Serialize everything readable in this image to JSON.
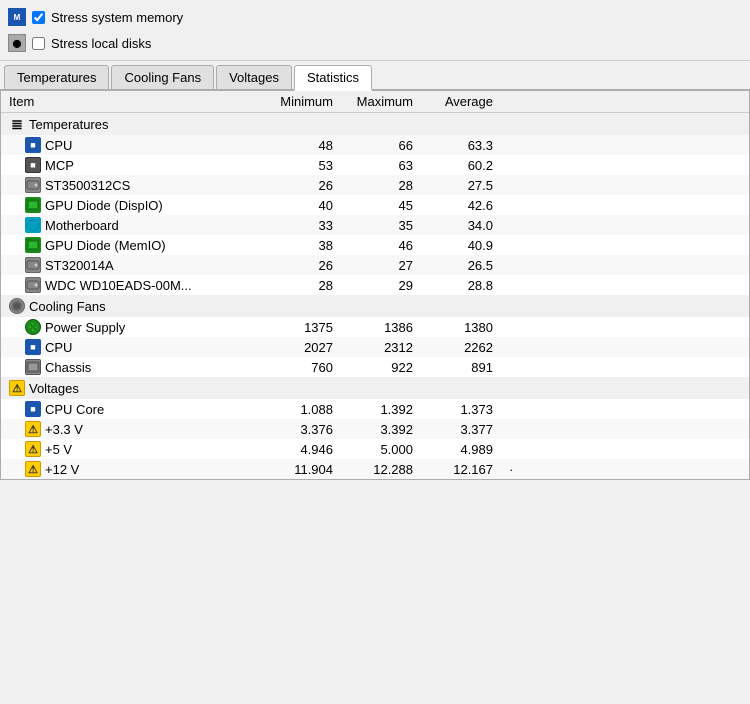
{
  "topSection": {
    "stressMemory": {
      "label": "Stress system memory",
      "checked": true
    },
    "stressDisks": {
      "label": "Stress local disks",
      "checked": false
    }
  },
  "tabs": [
    {
      "id": "temperatures",
      "label": "Temperatures",
      "active": false
    },
    {
      "id": "coolingfans",
      "label": "Cooling Fans",
      "active": false
    },
    {
      "id": "voltages",
      "label": "Voltages",
      "active": false
    },
    {
      "id": "statistics",
      "label": "Statistics",
      "active": true
    }
  ],
  "table": {
    "headers": {
      "item": "Item",
      "minimum": "Minimum",
      "maximum": "Maximum",
      "average": "Average"
    },
    "sections": [
      {
        "id": "temperatures",
        "label": "Temperatures",
        "iconType": "section-temp",
        "items": [
          {
            "id": "cpu",
            "label": "CPU",
            "iconType": "cpu",
            "min": "48",
            "max": "66",
            "avg": "63.3"
          },
          {
            "id": "mcp",
            "label": "MCP",
            "iconType": "mcp",
            "min": "53",
            "max": "63",
            "avg": "60.2"
          },
          {
            "id": "st3500312cs",
            "label": "ST3500312CS",
            "iconType": "hdd",
            "min": "26",
            "max": "28",
            "avg": "27.5"
          },
          {
            "id": "gpu-disp",
            "label": "GPU Diode (DispIO)",
            "iconType": "gpu",
            "min": "40",
            "max": "45",
            "avg": "42.6"
          },
          {
            "id": "mb",
            "label": "Motherboard",
            "iconType": "mb",
            "min": "33",
            "max": "35",
            "avg": "34.0"
          },
          {
            "id": "gpu-mem",
            "label": "GPU Diode (MemIO)",
            "iconType": "gpu",
            "min": "38",
            "max": "46",
            "avg": "40.9"
          },
          {
            "id": "st320014a",
            "label": "ST320014A",
            "iconType": "hdd",
            "min": "26",
            "max": "27",
            "avg": "26.5"
          },
          {
            "id": "wdc",
            "label": "WDC WD10EADS-00M...",
            "iconType": "hdd",
            "min": "28",
            "max": "29",
            "avg": "28.8"
          }
        ]
      },
      {
        "id": "coolingfans",
        "label": "Cooling Fans",
        "iconType": "section-fan",
        "items": [
          {
            "id": "power-supply",
            "label": "Power Supply",
            "iconType": "fan-ps",
            "min": "1375",
            "max": "1386",
            "avg": "1380"
          },
          {
            "id": "cpu-fan",
            "label": "CPU",
            "iconType": "cpu",
            "min": "2027",
            "max": "2312",
            "avg": "2262"
          },
          {
            "id": "chassis",
            "label": "Chassis",
            "iconType": "chassis",
            "min": "760",
            "max": "922",
            "avg": "891"
          }
        ]
      },
      {
        "id": "voltages",
        "label": "Voltages",
        "iconType": "volt",
        "items": [
          {
            "id": "cpu-core",
            "label": "CPU Core",
            "iconType": "cpu",
            "min": "1.088",
            "max": "1.392",
            "avg": "1.373"
          },
          {
            "id": "3v3",
            "label": "+3.3 V",
            "iconType": "volt",
            "min": "3.376",
            "max": "3.392",
            "avg": "3.377"
          },
          {
            "id": "5v",
            "label": "+5 V",
            "iconType": "volt",
            "min": "4.946",
            "max": "5.000",
            "avg": "4.989"
          },
          {
            "id": "12v",
            "label": "+12 V",
            "iconType": "volt",
            "min": "11.904",
            "max": "12.288",
            "avg": "12.167"
          }
        ]
      }
    ]
  }
}
